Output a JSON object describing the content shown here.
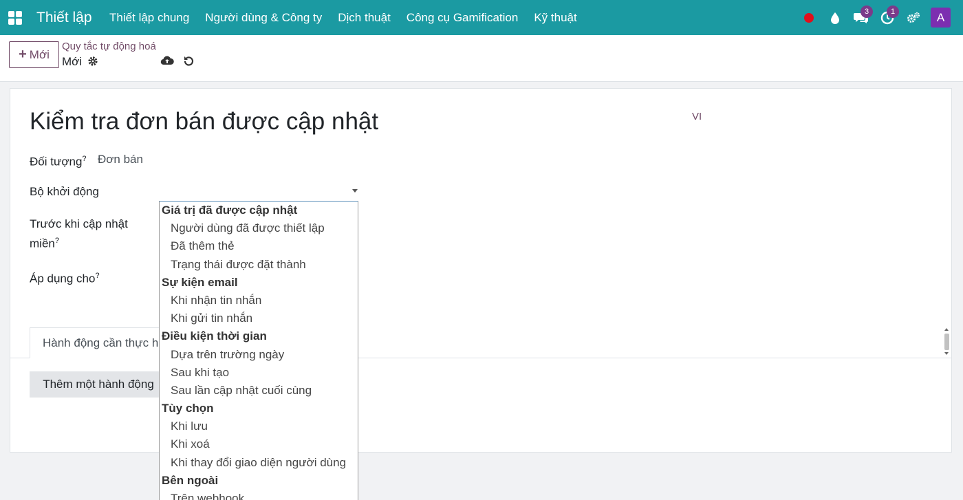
{
  "navbar": {
    "app_title": "Thiết lập",
    "menu": [
      "Thiết lập chung",
      "Người dùng & Công ty",
      "Dịch thuật",
      "Công cụ Gamification",
      "Kỹ thuật"
    ],
    "messages_badge": "3",
    "activities_badge": "1",
    "avatar_letter": "A",
    "colors": {
      "bar": "#1b9aa2",
      "recording": "#e0101c",
      "badge": "#7b3a8a",
      "avatar": "#7c2fb0"
    }
  },
  "control": {
    "new_label": "Mới",
    "breadcrumb": "Quy tắc tự động hoá",
    "record_name": "Mới"
  },
  "form": {
    "title": "Kiểm tra đơn bán được cập nhật",
    "lang": "VI",
    "fields": {
      "model_label": "Đối tượng",
      "model_help": "?",
      "model_value": "Đơn bán",
      "trigger_label": "Bộ khởi động",
      "before_update_label_1": "Trước khi cập nhật",
      "before_update_label_2": "miền",
      "before_update_help": "?",
      "apply_on_label": "Áp dụng cho",
      "apply_on_help": "?"
    },
    "tab_label": "Hành động cần thực hiện",
    "add_action_label": "Thêm một hành động"
  },
  "dropdown": {
    "groups": [
      {
        "label": "Giá trị đã được cập nhật",
        "options": [
          "Người dùng đã được thiết lập",
          "Đã thêm thẻ",
          "Trạng thái được đặt thành"
        ]
      },
      {
        "label": "Sự kiện email",
        "options": [
          "Khi nhận tin nhắn",
          "Khi gửi tin nhắn"
        ]
      },
      {
        "label": "Điều kiện thời gian",
        "options": [
          "Dựa trên trường ngày",
          "Sau khi tạo",
          "Sau lần cập nhật cuối cùng"
        ]
      },
      {
        "label": "Tùy chọn",
        "options": [
          "Khi lưu",
          "Khi xoá",
          "Khi thay đổi giao diện người dùng"
        ]
      },
      {
        "label": "Bên ngoài",
        "options": [
          "Trên webhook"
        ]
      }
    ]
  }
}
